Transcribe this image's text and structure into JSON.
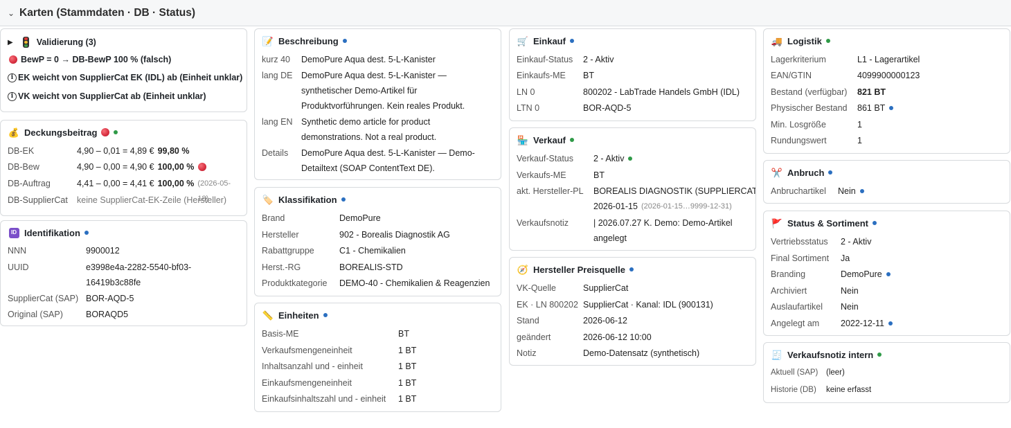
{
  "header": {
    "title": "Karten (Stammdaten · DB · Status)"
  },
  "validierung": {
    "title": "Validierung (3)",
    "line1": "BewP = 0 → DB-BewP 100 % (falsch)",
    "line2": "EK weicht von SupplierCat EK (IDL) ab (Einheit unklar)",
    "line3": "VK weicht von SupplierCat ab (Einheit unklar)"
  },
  "deckung": {
    "title": "Deckungsbeitrag",
    "rows": [
      {
        "k": "DB-EK",
        "calc": "4,90 – 0,01 = 4,89 €",
        "pct": "99,80 %"
      },
      {
        "k": "DB-Bew",
        "calc": "4,90 – 0,00 = 4,90 €",
        "pct": "100,00 %"
      },
      {
        "k": "DB-Auftrag",
        "calc": "4,41 – 0,00 = 4,41 €",
        "pct": "100,00 %",
        "note": "(2026-05-18)"
      },
      {
        "k": "DB-SupplierCat",
        "calc": "keine SupplierCat-EK-Zeile (Hersteller)"
      }
    ]
  },
  "ident": {
    "title": "Identifikation",
    "rows": [
      {
        "k": "NNN",
        "v": "9900012"
      },
      {
        "k": "UUID",
        "v": "e3998e4a-2282-5540-bf03-",
        "v2": "16419b3c88fe"
      },
      {
        "k": "SupplierCat (SAP)",
        "v": "BOR-AQD-5"
      },
      {
        "k": "Original (SAP)",
        "v": "BORAQD5"
      }
    ]
  },
  "beschreibung": {
    "title": "Beschreibung",
    "rows": [
      {
        "k": "kurz 40",
        "v": "DemoPure Aqua dest. 5-L-Kanister"
      },
      {
        "k": "lang DE",
        "v": "DemoPure Aqua dest. 5-L-Kanister —",
        "v2": "synthetischer Demo-Artikel für",
        "v3": "Produktvorführungen. Kein reales Produkt."
      },
      {
        "k": "lang EN",
        "v": "Synthetic demo article for product",
        "v2": "demonstrations. Not a real product."
      },
      {
        "k": "Details",
        "v": "DemoPure Aqua dest. 5-L-Kanister — Demo-",
        "v2": "Detailtext (SOAP ContentText DE)."
      }
    ]
  },
  "klass": {
    "title": "Klassifikation",
    "rows": [
      {
        "k": "Brand",
        "v": "DemoPure"
      },
      {
        "k": "Hersteller",
        "v": "902 - Borealis Diagnostik AG"
      },
      {
        "k": "Rabattgruppe",
        "v": "C1 - Chemikalien"
      },
      {
        "k": "Herst.-RG",
        "v": "BOREALIS-STD"
      },
      {
        "k": "Produktkategorie",
        "v": "DEMO-40 - Chemikalien & Reagenzien"
      }
    ]
  },
  "einheiten": {
    "title": "Einheiten",
    "rows": [
      {
        "k": "Basis-ME",
        "v": "BT"
      },
      {
        "k": "Verkaufsmengeneinheit",
        "v": "1 BT"
      },
      {
        "k": "Inhaltsanzahl und - einheit",
        "v": "1 BT"
      },
      {
        "k": "Einkaufsmengeneinheit",
        "v": "1 BT"
      },
      {
        "k": "Einkaufsinhaltszahl und - einheit",
        "v": "1 BT"
      }
    ]
  },
  "einkauf": {
    "title": "Einkauf",
    "rows": [
      {
        "k": "Einkauf-Status",
        "v": "2 - Aktiv"
      },
      {
        "k": "Einkaufs-ME",
        "v": "BT"
      },
      {
        "k": "LN 0",
        "v": "800202 - LabTrade Handels GmbH (IDL)"
      },
      {
        "k": "LTN 0",
        "v": "BOR-AQD-5"
      }
    ]
  },
  "verkauf": {
    "title": "Verkauf",
    "rows": [
      {
        "k": "Verkauf-Status",
        "v": "2 - Aktiv"
      },
      {
        "k": "Verkaufs-ME",
        "v": "BT"
      },
      {
        "k": "akt. Hersteller-PL",
        "v": "BOREALIS DIAGNOSTIK (SUPPLIERCAT)",
        "v2": "2026-01-15",
        "note": "(2026-01-15…9999-12-31)"
      },
      {
        "k": "Verkaufsnotiz",
        "v": "| 2026.07.27 K. Demo: Demo-Artikel",
        "v2": "angelegt"
      }
    ]
  },
  "hersteller": {
    "title": "Hersteller Preisquelle",
    "rows": [
      {
        "k": "VK-Quelle",
        "v": "SupplierCat"
      },
      {
        "k": "EK · LN 800202",
        "v": "SupplierCat · Kanal: IDL (900131)"
      },
      {
        "k": "Stand",
        "v": "2026-06-12"
      },
      {
        "k": "geändert",
        "v": "2026-06-12 10:00"
      },
      {
        "k": "Notiz",
        "v": "Demo-Datensatz (synthetisch)"
      }
    ]
  },
  "logistik": {
    "title": "Logistik",
    "rows": [
      {
        "k": "Lagerkriterium",
        "v": "L1 - Lagerartikel"
      },
      {
        "k": "EAN/GTIN",
        "v": "4099900000123"
      },
      {
        "k": "Bestand (verfügbar)",
        "v": "821 BT"
      },
      {
        "k": "Physischer Bestand",
        "v": "861 BT"
      },
      {
        "k": "Min. Losgröße",
        "v": "1"
      },
      {
        "k": "Rundungswert",
        "v": "1"
      }
    ]
  },
  "anbruch": {
    "title": "Anbruch",
    "rows": [
      {
        "k": "Anbruchartikel",
        "v": "Nein"
      }
    ]
  },
  "status": {
    "title": "Status & Sortiment",
    "rows": [
      {
        "k": "Vertriebsstatus",
        "v": "2 - Aktiv"
      },
      {
        "k": "Final Sortiment",
        "v": "Ja"
      },
      {
        "k": "Branding",
        "v": "DemoPure"
      },
      {
        "k": "Archiviert",
        "v": "Nein"
      },
      {
        "k": "Auslaufartikel",
        "v": "Nein"
      },
      {
        "k": "Angelegt am",
        "v": "2022-12-11"
      }
    ]
  },
  "notiz": {
    "title": "Verkaufsnotiz intern",
    "rows": [
      {
        "k": "Aktuell (SAP)",
        "v": "(leer)"
      },
      {
        "k": "Historie (DB)",
        "v": "keine erfasst"
      }
    ]
  },
  "colors": {
    "accent_blue": "#2b6fc0",
    "ok_green": "#2f9a47",
    "warn_red": "#d0342c"
  }
}
